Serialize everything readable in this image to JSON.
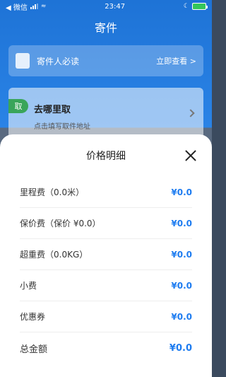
{
  "status_bar": {
    "back_app": "◀ 微信",
    "time": "23:47"
  },
  "page_title": "寄件",
  "notice": {
    "title": "寄件人必读",
    "link": "立即查看 >"
  },
  "address": {
    "tag": "取",
    "title": "去哪里取",
    "subtitle": "点击填写取件地址"
  },
  "modal": {
    "title": "价格明细",
    "rows": [
      {
        "label": "里程费（0.0米）",
        "value": "¥0.0"
      },
      {
        "label": "保价费（保价 ¥0.0）",
        "value": "¥0.0"
      },
      {
        "label": "超重费（0.0KG）",
        "value": "¥0.0"
      },
      {
        "label": "小费",
        "value": "¥0.0"
      },
      {
        "label": "优惠券",
        "value": "¥0.0"
      },
      {
        "label": "总金额",
        "value": "¥0.0"
      }
    ]
  },
  "colors": {
    "primary": "#1e73d6",
    "price": "#1e7cf0",
    "tag_green": "#3aa55a"
  }
}
